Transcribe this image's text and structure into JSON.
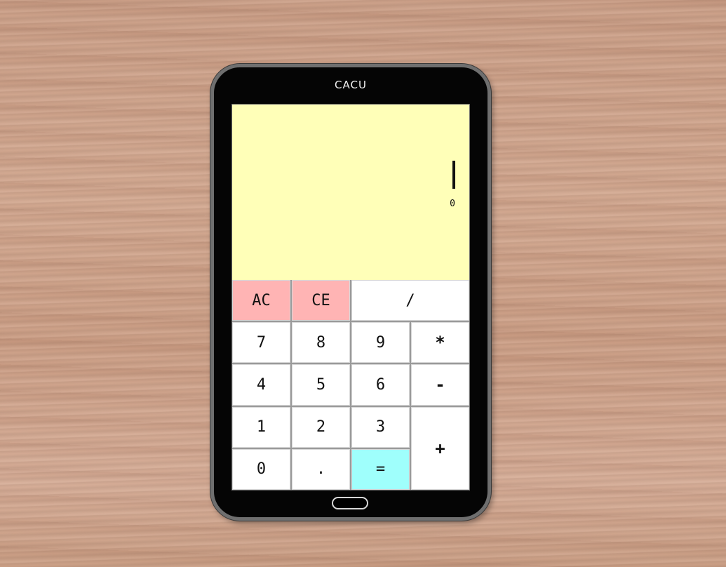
{
  "device": {
    "brand": "CACU"
  },
  "display": {
    "value": "0"
  },
  "keys": {
    "ac": "AC",
    "ce": "CE",
    "divide": "/",
    "seven": "7",
    "eight": "8",
    "nine": "9",
    "multiply": "*",
    "four": "4",
    "five": "5",
    "six": "6",
    "minus": "-",
    "one": "1",
    "two": "2",
    "three": "3",
    "plus": "+",
    "zero": "0",
    "decimal": ".",
    "equals": "="
  },
  "colors": {
    "display_bg": "#ffffb8",
    "clear_keys": "#ffb4b4",
    "equals_key": "#9ffffc",
    "device_body": "#050505"
  }
}
